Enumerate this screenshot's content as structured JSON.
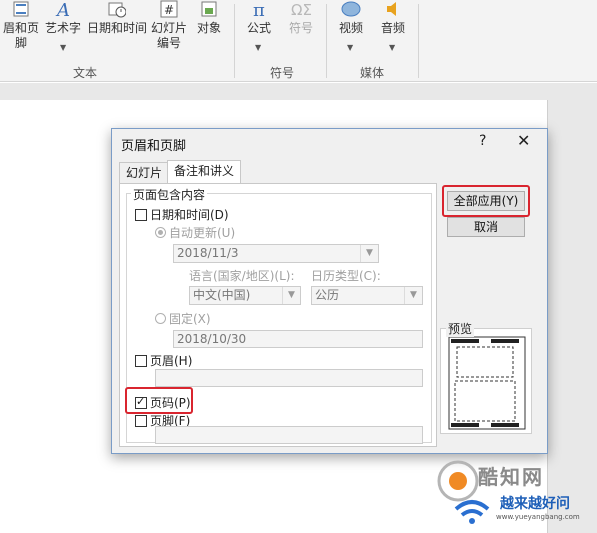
{
  "ribbon": {
    "buttons": {
      "header_footer": "眉和页脚",
      "wordart": "艺术字",
      "date_time": "日期和时间",
      "slide_number_line1": "幻灯片",
      "slide_number_line2": "编号",
      "object": "对象",
      "equation": "公式",
      "symbol": "符号",
      "video": "视频",
      "audio": "音频"
    },
    "groups": {
      "text": "文本",
      "symbols": "符号",
      "media": "媒体"
    }
  },
  "dialog": {
    "title": "页眉和页脚",
    "help": "?",
    "close": "✕",
    "tabs": [
      "幻灯片",
      "备注和讲义"
    ],
    "active_tab": 1,
    "group_label": "页面包含内容",
    "date_time": {
      "label": "日期和时间(D)",
      "checked": false
    },
    "auto_update": {
      "label": "自动更新(U)",
      "selected": true,
      "value": "2018/11/3"
    },
    "language": {
      "label": "语言(国家/地区)(L):",
      "value": "中文(中国)"
    },
    "calendar": {
      "label": "日历类型(C):",
      "value": "公历"
    },
    "fixed": {
      "label": "固定(X)",
      "selected": false,
      "value": "2018/10/30"
    },
    "header": {
      "label": "页眉(H)",
      "checked": false,
      "value": ""
    },
    "page_number": {
      "label": "页码(P)",
      "checked": true
    },
    "footer": {
      "label": "页脚(F)",
      "checked": false,
      "value": ""
    },
    "apply_all": "全部应用(Y)",
    "cancel": "取消",
    "preview_label": "预览"
  },
  "watermark": {
    "title": "酷知网",
    "subtitle": "越来越好问",
    "url": "www.yueyangbang.com"
  },
  "colors": {
    "highlight": "#d9252f",
    "dialog_border": "#7a9cc7"
  }
}
